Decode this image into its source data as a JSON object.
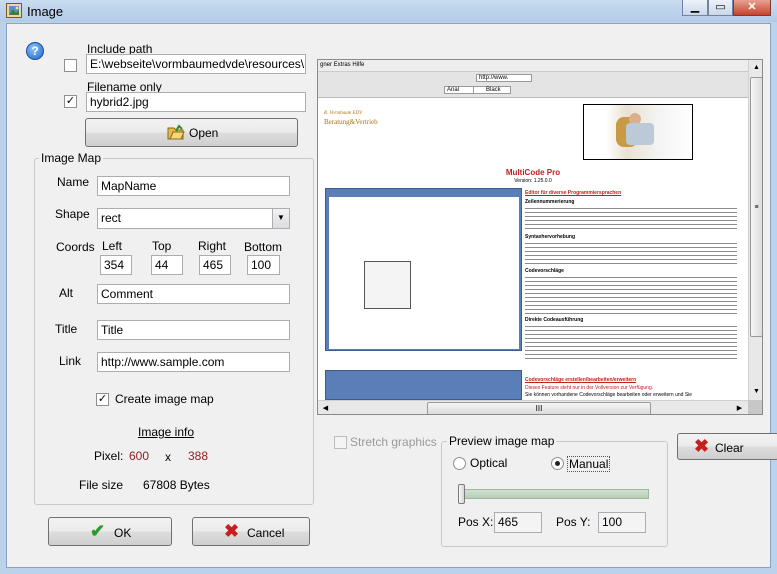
{
  "window": {
    "title": "Image",
    "icon": "picture-icon",
    "min_glyph": "▁",
    "max_glyph": "▭",
    "close_glyph": "✕"
  },
  "help": {
    "glyph": "?"
  },
  "file": {
    "include_path_label": "Include path",
    "include_path_value": "E:\\webseite\\vormbaumedvde\\resources\\hybri",
    "include_path_checked": false,
    "filename_only_label": "Filename only",
    "filename_only_value": "hybrid2.jpg",
    "filename_only_checked": true,
    "open_label": "Open"
  },
  "image_map": {
    "group_label": "Image Map",
    "name_label": "Name",
    "name_value": "MapName",
    "shape_label": "Shape",
    "shape_value": "rect",
    "coords_label": "Coords",
    "left_label": "Left",
    "left_value": "354",
    "top_label": "Top",
    "top_value": "44",
    "right_label": "Right",
    "right_value": "465",
    "bottom_label": "Bottom",
    "bottom_value": "100",
    "alt_label": "Alt",
    "alt_value": "Comment",
    "title_label": "Title",
    "title_value": "Title",
    "link_label": "Link",
    "link_value": "http://www.sample.com",
    "create_label": "Create image map",
    "create_checked": true,
    "info_label": "Image info",
    "pixel_label": "Pixel:",
    "pixel_w": "600",
    "pixel_x": "x",
    "pixel_h": "388",
    "filesize_label": "File size",
    "filesize_value": "67808 Bytes"
  },
  "buttons": {
    "ok": "OK",
    "cancel": "Cancel",
    "clear": "Clear"
  },
  "preview": {
    "stretch_label": "Stretch graphics",
    "stretch_checked": false,
    "group_label": "Preview image map",
    "optical_label": "Optical",
    "manual_label": "Manual",
    "selected": "manual",
    "slider_value": 0,
    "posx_label": "Pos X:",
    "posx_value": "465",
    "posy_label": "Pos Y:",
    "posy_value": "100",
    "scroll_thumb_glyph": "III",
    "shot": {
      "menu": "gner   Extras   Hilfe",
      "url": "http://www.",
      "font": "Arial",
      "color_name": "Black",
      "brand1": "R. Vormbaum EDV",
      "brand2": "Beratung&Vertrieb",
      "heading": "MultiCode Pro",
      "version": "Version: 1.25.0.0",
      "sec1": "Editor für diverse Programmiersprachen",
      "sub1": "Zeilennummerierung",
      "sub2": "Syntaxhervorhebung",
      "sub3": "Codevorschläge",
      "sub4": "Direkte Codeausführung",
      "sec2": "Codevorschläge erstellen/bearbeiten/erweitern",
      "sec2_sub": "Dieses Feature steht nur in der Vollversion zur Verfügung.",
      "sec2_text": "Sie können vorhandene Codevorschläge bearbeiten oder erweitern und Sie"
    }
  }
}
